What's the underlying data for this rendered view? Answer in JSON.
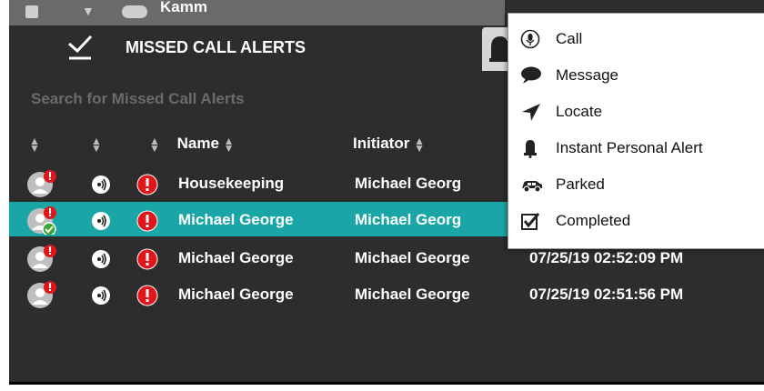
{
  "top_strip": {
    "peek_text": "Kamm"
  },
  "header": {
    "title": "MISSED CALL ALERTS"
  },
  "search": {
    "placeholder": "Search for Missed Call Alerts"
  },
  "columns": {
    "name": "Name",
    "initiator": "Initiator"
  },
  "rows": [
    {
      "name": "Housekeeping",
      "initiator": "Michael Georg",
      "time": "",
      "selected": false,
      "avatar_check": false,
      "icons": [
        "group-avatar-icon",
        "radio-signal-icon",
        "alert-icon"
      ]
    },
    {
      "name": "Michael George",
      "initiator": "Michael Georg",
      "time": "",
      "selected": true,
      "avatar_check": true,
      "icons": [
        "user-avatar-icon",
        "radio-signal-icon",
        "alert-icon"
      ]
    },
    {
      "name": "Michael George",
      "initiator": "Michael George",
      "time": "07/25/19 02:52:09 PM",
      "selected": false,
      "avatar_check": false,
      "icons": [
        "user-avatar-icon",
        "radio-signal-icon",
        "alert-icon"
      ]
    },
    {
      "name": "Michael George",
      "initiator": "Michael George",
      "time": "07/25/19 02:51:56 PM",
      "selected": false,
      "avatar_check": false,
      "icons": [
        "user-avatar-icon",
        "radio-signal-icon",
        "alert-icon"
      ]
    }
  ],
  "menu": {
    "items": [
      {
        "label": "Call",
        "icon": "microphone-icon"
      },
      {
        "label": "Message",
        "icon": "speech-bubble-icon"
      },
      {
        "label": "Locate",
        "icon": "location-arrow-icon"
      },
      {
        "label": "Instant Personal Alert",
        "icon": "bell-icon"
      },
      {
        "label": "Parked",
        "icon": "car-icon"
      },
      {
        "label": "Completed",
        "icon": "checkbox-icon"
      }
    ]
  },
  "colors": {
    "panel": "#2d2d2d",
    "selected_row": "#1aa6a6",
    "alert_red": "#e0161b",
    "badge_green": "#3aa832"
  }
}
